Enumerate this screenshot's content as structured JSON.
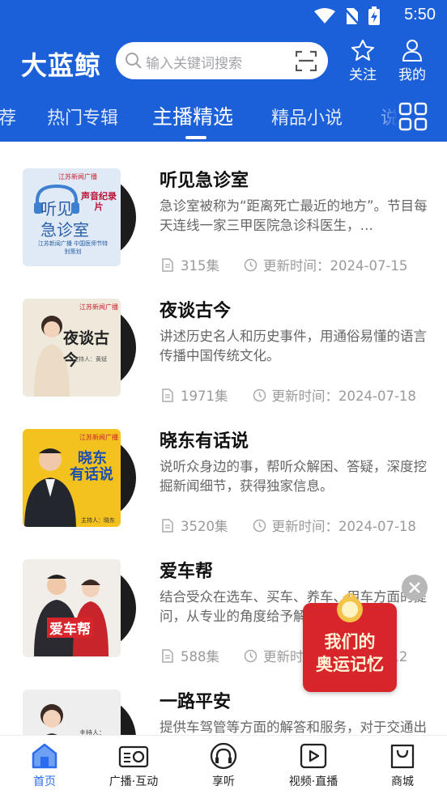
{
  "status_bar": {
    "time": "5:50"
  },
  "header": {
    "brand": "大蓝鲸",
    "search_placeholder": "输入关键词搜索",
    "follow_label": "关注",
    "mine_label": "我的"
  },
  "tabs": [
    {
      "label": "荐",
      "active": false
    },
    {
      "label": "热门专辑",
      "active": false
    },
    {
      "label": "主播精选",
      "active": true
    },
    {
      "label": "精品小说",
      "active": false
    },
    {
      "label": "说",
      "active": false
    }
  ],
  "items": [
    {
      "title": "听见急诊室",
      "desc": "急诊室被称为“距离死亡最近的地方”。节目每天连线一家三甲医院急诊科医生，…",
      "episodes": "315集",
      "updated": "更新时间：2024-07-15",
      "cover": {
        "bg": "#dfeaf6",
        "station": "江苏新闻广播",
        "big1": "听见",
        "big2": "急诊室",
        "tag": "声音纪录片",
        "sub": "江苏新闻广播 中国医师节特别策划"
      }
    },
    {
      "title": "夜谈古今",
      "desc": "讲述历史名人和历史事件，用通俗易懂的语言传播中国传统文化。",
      "episodes": "1971集",
      "updated": "更新时间：2024-07-18",
      "cover": {
        "bg": "#efe9dc",
        "station": "江苏新闻广播",
        "big1": "夜谈古今",
        "host": "主持人：黄斌"
      }
    },
    {
      "title": "晓东有话说",
      "desc": "说听众身边的事，帮听众解困、答疑，深度挖掘新闻细节，获得独家信息。",
      "episodes": "3520集",
      "updated": "更新时间：2024-07-18",
      "cover": {
        "bg": "#f4c21f",
        "station": "江苏新闻广播",
        "big1": "晓东",
        "big2": "有话说",
        "host": "主持人：晓东"
      }
    },
    {
      "title": "爱车帮",
      "desc": "结合受众在选车、买车、养车、用车方面的提问，从专业的角度给予解答。",
      "episodes": "588集",
      "updated": "更新时间：2024-07-12",
      "cover": {
        "bg": "#f1eeea",
        "big1": "爱车帮"
      }
    },
    {
      "title": "一路平安",
      "desc": "提供车驾管等方面的解答和服务，对于交通出行方面的问题给予解答。",
      "episodes": "",
      "updated": "",
      "cover": {
        "bg": "#eeeeee",
        "host": "主持人："
      }
    }
  ],
  "float_banner": {
    "line1": "我们的",
    "line2": "奥运记忆"
  },
  "bottom_nav": [
    {
      "label": "首页",
      "active": true,
      "icon": "home-icon"
    },
    {
      "label": "广播·互动",
      "active": false,
      "icon": "radio-icon"
    },
    {
      "label": "享听",
      "active": false,
      "icon": "headphones-icon"
    },
    {
      "label": "视频·直播",
      "active": false,
      "icon": "video-icon"
    },
    {
      "label": "商城",
      "active": false,
      "icon": "shop-bag-icon"
    }
  ],
  "colors": {
    "brand_blue": "#1b5fd9",
    "active_nav": "#2a6cf0",
    "banner_red": "#d8242b"
  }
}
